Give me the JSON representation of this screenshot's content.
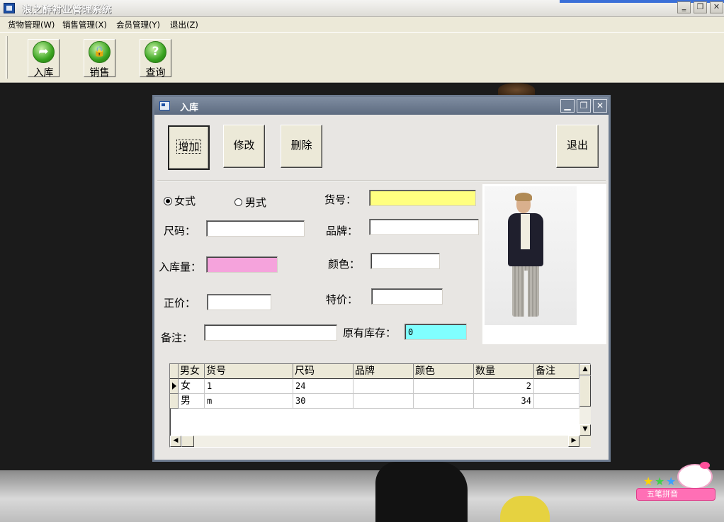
{
  "app": {
    "title": "浪之醉衬业管理系统",
    "window_controls": {
      "minimize": "‗",
      "restore": "❐",
      "close": "✕"
    }
  },
  "menubar": {
    "items": [
      {
        "label": "货物管理(W)"
      },
      {
        "label": "销售管理(X)"
      },
      {
        "label": "会员管理(Y)"
      },
      {
        "label": "退出(Z)"
      }
    ]
  },
  "toolbar": {
    "buttons": [
      {
        "label": "入库",
        "icon": "arrow-right-icon",
        "glyph": "➦"
      },
      {
        "label": "销售",
        "icon": "lock-icon",
        "glyph": "🔒"
      },
      {
        "label": "查询",
        "icon": "help-icon",
        "glyph": "?"
      }
    ]
  },
  "dialog": {
    "title": "入库",
    "controls": {
      "minimize": "▁",
      "maximize": "❐",
      "close": "✕"
    },
    "buttons": {
      "add": "增加",
      "edit": "修改",
      "delete": "删除",
      "exit": "退出"
    },
    "gender": {
      "female": "女式",
      "male": "男式",
      "selected": "female"
    },
    "labels": {
      "item_no": "货号：",
      "size": "尺码：",
      "brand": "品牌：",
      "qty_in": "入库量：",
      "color": "颜色：",
      "price": "正价：",
      "special_price": "特价：",
      "remark": "备注：",
      "orig_stock": "原有库存："
    },
    "fields": {
      "item_no": "",
      "size": "",
      "brand": "",
      "qty_in": "",
      "color": "",
      "price": "",
      "special_price": "",
      "remark": "",
      "orig_stock": "0"
    },
    "field_colors": {
      "item_no": "#ffff80",
      "qty_in": "#f5a3dc",
      "orig_stock": "#80ffff"
    },
    "grid": {
      "columns": [
        "男女",
        "货号",
        "尺码",
        "品牌",
        "颜色",
        "数量",
        "备注"
      ],
      "rows": [
        {
          "gender": "女",
          "item_no": "1",
          "size": "24",
          "brand": "",
          "color": "",
          "qty": "2",
          "remark": ""
        },
        {
          "gender": "男",
          "item_no": "m",
          "size": "30",
          "brand": "",
          "color": "",
          "qty": "34",
          "remark": ""
        }
      ]
    }
  },
  "tray": {
    "label": "五笔拼音"
  }
}
